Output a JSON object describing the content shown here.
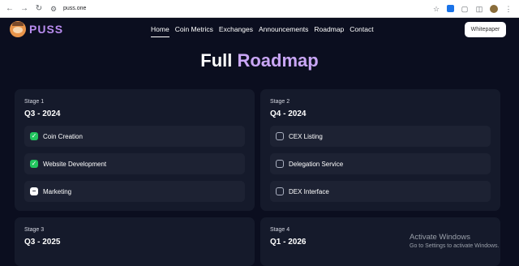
{
  "browser": {
    "url": "puss.one"
  },
  "site": {
    "logo_text": "PUSS",
    "nav": [
      "Home",
      "Coin Metrics",
      "Exchanges",
      "Announcements",
      "Roadmap",
      "Contact"
    ],
    "whitepaper_label": "Whitepaper"
  },
  "page": {
    "title_part1": "Full",
    "title_part2": "Roadmap"
  },
  "stages": [
    {
      "label": "Stage 1",
      "period": "Q3 - 2024",
      "tasks": [
        {
          "name": "Coin Creation",
          "status": "done"
        },
        {
          "name": "Website Development",
          "status": "done"
        },
        {
          "name": "Marketing",
          "status": "in-progress"
        }
      ]
    },
    {
      "label": "Stage 2",
      "period": "Q4 - 2024",
      "tasks": [
        {
          "name": "CEX Listing",
          "status": "pending"
        },
        {
          "name": "Delegation Service",
          "status": "pending"
        },
        {
          "name": "DEX Interface",
          "status": "pending"
        }
      ]
    },
    {
      "label": "Stage 3",
      "period": "Q3 - 2025",
      "tasks": []
    },
    {
      "label": "Stage 4",
      "period": "Q1 - 2026",
      "tasks": []
    }
  ],
  "watermark": {
    "line1": "Activate Windows",
    "line2": "Go to Settings to activate Windows."
  },
  "colors": {
    "bg": "#0b0e1f",
    "card": "#151a2b",
    "task": "#1d2233",
    "accent": "#c9a6f5",
    "check": "#22c55e"
  }
}
